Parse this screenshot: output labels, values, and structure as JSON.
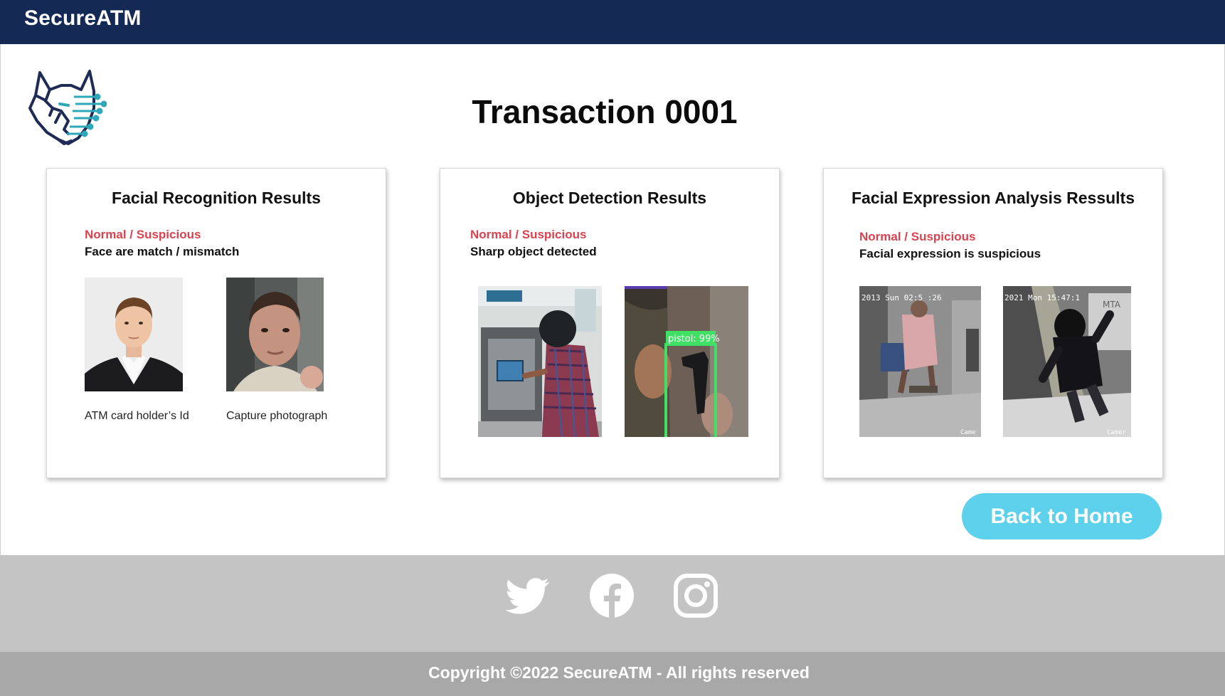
{
  "header": {
    "brand": "SecureATM"
  },
  "page": {
    "title": "Transaction 0001"
  },
  "cards": [
    {
      "title": "Facial Recognition Results",
      "status": "Normal / Suspicious",
      "description": "Face are match / mismatch",
      "images": [
        {
          "name": "atm-card-holder-id-photo",
          "caption": "ATM card holder’s Id"
        },
        {
          "name": "capture-photograph",
          "caption": "Capture photograph"
        }
      ]
    },
    {
      "title": "Object Detection Results",
      "status": "Normal / Suspicious",
      "description": "Sharp object detected",
      "images": [
        {
          "name": "atm-user-helmet-photo"
        },
        {
          "name": "pistol-detection-photo",
          "detection_label": "pistol: 99%"
        }
      ]
    },
    {
      "title": "Facial Expression Analysis Ressults",
      "status": "Normal / Suspicious",
      "description": "Facial expression is suspicious",
      "images": [
        {
          "name": "cctv-frame-1",
          "overlay_text": "2013 Sun 02:5 :26",
          "corner_text": "Came"
        },
        {
          "name": "cctv-frame-2",
          "overlay_text": "2021 Mon 15:47:1",
          "corner_text": "Camer",
          "sign_text": "MTA"
        }
      ]
    }
  ],
  "actions": {
    "back_label": "Back to Home"
  },
  "footer": {
    "social_icons": [
      "twitter-icon",
      "facebook-icon",
      "instagram-icon"
    ],
    "copyright": "Copyright ©2022 SecureATM - All rights reserved"
  },
  "colors": {
    "header_bg": "#142953",
    "status_red": "#d9434f",
    "button_cyan": "#5dd0ec",
    "footer_light": "#c4c4c4",
    "footer_dark": "#a8a8a8"
  }
}
